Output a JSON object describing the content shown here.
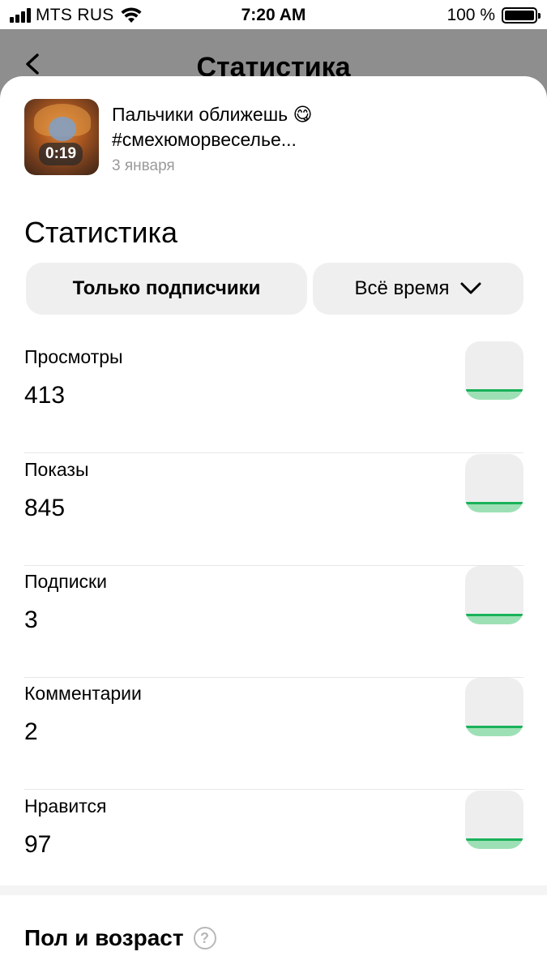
{
  "status_bar": {
    "carrier": "MTS RUS",
    "time": "7:20 AM",
    "battery": "100 %"
  },
  "background_page": {
    "title": "Статистика"
  },
  "video": {
    "duration": "0:19",
    "title_line1": "Пальчики оближешь 😋",
    "title_line2": "#смехюморвеселье...",
    "date": "3 января"
  },
  "statistics": {
    "title": "Статистика",
    "filter_audience": "Только подписчики",
    "filter_period": "Всё время",
    "metrics": [
      {
        "label": "Просмотры",
        "value": "413"
      },
      {
        "label": "Показы",
        "value": "845"
      },
      {
        "label": "Подписки",
        "value": "3"
      },
      {
        "label": "Комментарии",
        "value": "2"
      },
      {
        "label": "Нравится",
        "value": "97"
      }
    ]
  },
  "demographics": {
    "title": "Пол и возраст",
    "help_icon": "question-circle-icon"
  },
  "colors": {
    "accent_green": "#19b25a",
    "accent_green_light": "#9ee0b5",
    "chip_bg": "#efefef"
  }
}
